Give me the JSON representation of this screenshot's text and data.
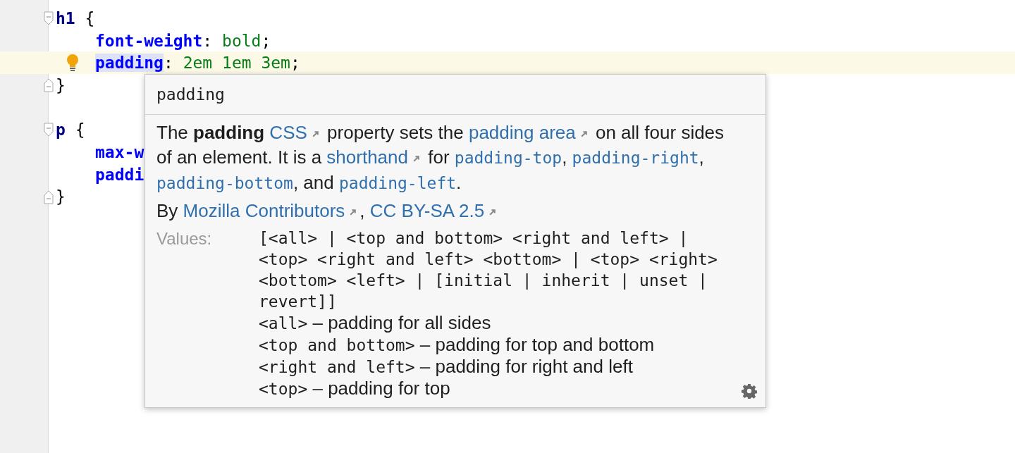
{
  "editor": {
    "lines": [
      {
        "kind": "block-start",
        "current": false,
        "intention": false,
        "tokens": [
          {
            "text": "h1",
            "kind": "selector",
            "highlighted": false
          },
          {
            "text": " {",
            "kind": "punct",
            "highlighted": false
          }
        ]
      },
      {
        "kind": "declaration",
        "current": false,
        "intention": false,
        "tokens": [
          {
            "text": "font-weight",
            "kind": "property",
            "highlighted": false
          },
          {
            "text": ": ",
            "kind": "punct",
            "highlighted": false
          },
          {
            "text": "bold",
            "kind": "value",
            "highlighted": false
          },
          {
            "text": ";",
            "kind": "punct",
            "highlighted": false
          }
        ]
      },
      {
        "kind": "declaration",
        "current": true,
        "intention": true,
        "tokens": [
          {
            "text": "padding",
            "kind": "property",
            "highlighted": true
          },
          {
            "text": ": ",
            "kind": "punct",
            "highlighted": false
          },
          {
            "text": "2em 1em 3em",
            "kind": "value",
            "highlighted": false
          },
          {
            "text": ";",
            "kind": "punct",
            "highlighted": false
          }
        ]
      },
      {
        "kind": "block-end",
        "current": false,
        "intention": false,
        "tokens": [
          {
            "text": "}",
            "kind": "punct",
            "highlighted": false
          }
        ]
      },
      {
        "kind": "blank",
        "current": false,
        "intention": false
      },
      {
        "kind": "block-start",
        "current": false,
        "intention": false,
        "tokens": [
          {
            "text": "p",
            "kind": "selector",
            "highlighted": false
          },
          {
            "text": " {",
            "kind": "punct",
            "highlighted": false
          }
        ]
      },
      {
        "kind": "declaration",
        "current": false,
        "intention": false,
        "tokens": [
          {
            "text": "max-w",
            "kind": "property",
            "highlighted": false
          }
        ]
      },
      {
        "kind": "declaration",
        "current": false,
        "intention": false,
        "tokens": [
          {
            "text": "paddi",
            "kind": "property",
            "highlighted": false
          }
        ]
      },
      {
        "kind": "block-end",
        "current": false,
        "intention": false,
        "tokens": [
          {
            "text": "}",
            "kind": "punct",
            "highlighted": false
          }
        ]
      }
    ]
  },
  "doc_popup": {
    "title": "padding",
    "description": [
      {
        "text": "The **padding** ",
        "kind": "text"
      },
      {
        "text": "CSS",
        "kind": "link"
      },
      {
        "text": " property sets the ",
        "kind": "text"
      },
      {
        "text": "padding area",
        "kind": "link"
      },
      {
        "text": " on all four sides of an element. It is a ",
        "kind": "text"
      },
      {
        "text": "shorthand",
        "kind": "link"
      },
      {
        "text": " for ",
        "kind": "text"
      },
      {
        "text": "padding-top",
        "kind": "code-link"
      },
      {
        "text": ", ",
        "kind": "text"
      },
      {
        "text": "padding-right",
        "kind": "code-link"
      },
      {
        "text": ", ",
        "kind": "text"
      },
      {
        "text": "padding-bottom",
        "kind": "code-link"
      },
      {
        "text": ", and ",
        "kind": "text"
      },
      {
        "text": "padding-left",
        "kind": "code-link"
      },
      {
        "text": ".",
        "kind": "text"
      }
    ],
    "attribution": [
      {
        "text": "By ",
        "kind": "text"
      },
      {
        "text": "Mozilla Contributors",
        "kind": "link"
      },
      {
        "text": ", ",
        "kind": "text"
      },
      {
        "text": "CC BY-SA 2.5",
        "kind": "link"
      }
    ],
    "values_label": "Values:",
    "syntax": "[<all> | <top and bottom> <right and left> | <top> <right and left> <bottom> | <top> <right> <bottom> <left> | [initial | inherit | unset | revert]]",
    "value_items": [
      {
        "term": "<all>",
        "desc": "– padding for all sides"
      },
      {
        "term": "<top and bottom>",
        "desc": "– padding for top and bottom"
      },
      {
        "term": "<right and left>",
        "desc": "– padding for right and left"
      },
      {
        "term": "<top>",
        "desc": "– padding for top"
      }
    ]
  }
}
